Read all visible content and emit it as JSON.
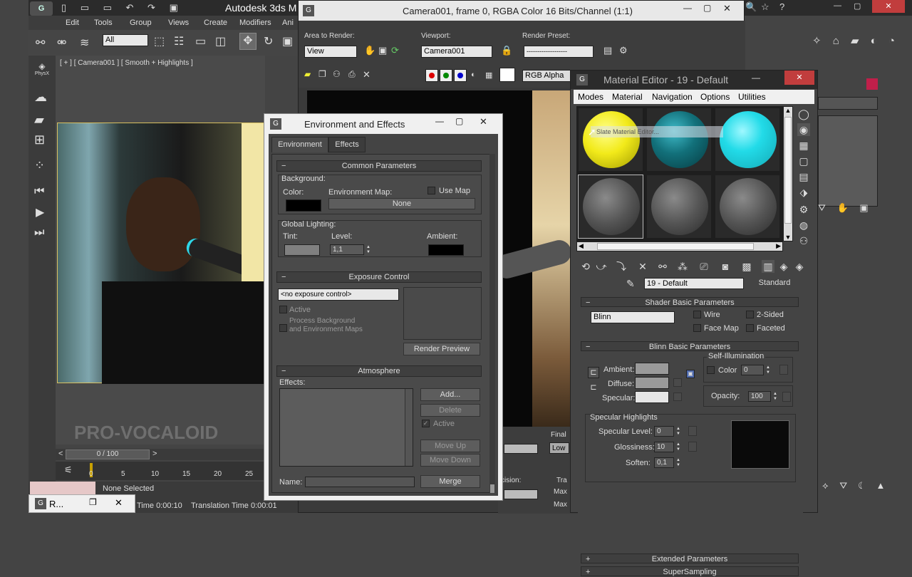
{
  "main_app": {
    "title": "Autodesk 3ds M",
    "menu": [
      "Edit",
      "Tools",
      "Group",
      "Views",
      "Create",
      "Modifiers",
      "Ani"
    ],
    "selection_filter": "All",
    "viewport_label": "[ + ] [ Camera001 ] [ Smooth + Highlights ]",
    "timeline_counter": "0 / 100",
    "timeline_ticks": [
      "0",
      "5",
      "10",
      "15",
      "20",
      "25"
    ],
    "status_none_selected": "None Selected",
    "render_time": "Time  0:00:10",
    "translation_time": "Translation Time  0:00:01",
    "taskbar_item": "R...",
    "watermark": "PRO-VOCALOID",
    "phys_label": "PhysX"
  },
  "render_window": {
    "title": "Camera001, frame 0, RGBA Color 16 Bits/Channel (1:1)",
    "area_label": "Area to Render:",
    "area_value": "View",
    "viewport_label": "Viewport:",
    "viewport_value": "Camera001",
    "preset_label": "Render Preset:",
    "preset_value": "-------------------",
    "channel_value": "RGB Alpha",
    "final_label": "Final",
    "low_value": "Low",
    "tra_label": "Tra",
    "max_label1": "Max",
    "max_label2": "Max",
    "cision_label": "cision:"
  },
  "env_effects": {
    "title": "Environment and Effects",
    "tab_environment": "Environment",
    "tab_effects": "Effects",
    "common_params": "Common Parameters",
    "background": "Background:",
    "color": "Color:",
    "env_map": "Environment Map:",
    "use_map": "Use Map",
    "none": "None",
    "global_lighting": "Global Lighting:",
    "tint": "Tint:",
    "level": "Level:",
    "level_value": "1,1",
    "ambient": "Ambient:",
    "exposure_control": "Exposure Control",
    "exposure_value": "<no exposure control>",
    "active": "Active",
    "process_bg_line1": "Process Background",
    "process_bg_line2": "and Environment Maps",
    "render_preview": "Render Preview",
    "atmosphere": "Atmosphere",
    "effects": "Effects:",
    "add": "Add...",
    "delete": "Delete",
    "atm_active": "Active",
    "move_up": "Move Up",
    "move_down": "Move Down",
    "name": "Name:",
    "merge": "Merge"
  },
  "material_editor": {
    "title": "Material Editor - 19 - Default",
    "menu": [
      "Modes",
      "Material",
      "Navigation",
      "Options",
      "Utilities"
    ],
    "tooltip": "Slate Material Editor...",
    "sphere_colors": [
      "#f2ea1a",
      "#12707a",
      "#22dbe8",
      "#555555",
      "#555555",
      "#555555"
    ],
    "material_name": "19 - Default",
    "material_type": "Standard",
    "shader_basic": "Shader Basic Parameters",
    "shader_value": "Blinn",
    "wire": "Wire",
    "two_sided": "2-Sided",
    "face_map": "Face Map",
    "faceted": "Faceted",
    "blinn_basic": "Blinn Basic Parameters",
    "self_illum": "Self-Illumination",
    "ambient": "Ambient:",
    "diffuse": "Diffuse:",
    "specular": "Specular:",
    "color": "Color",
    "color_value": "0",
    "opacity": "Opacity:",
    "opacity_value": "100",
    "specular_highlights": "Specular Highlights",
    "spec_level": "Specular Level:",
    "spec_level_value": "0",
    "glossiness": "Glossiness:",
    "glossiness_value": "10",
    "soften": "Soften:",
    "soften_value": "0,1",
    "extended": "Extended Parameters",
    "supersampling": "SuperSampling"
  }
}
